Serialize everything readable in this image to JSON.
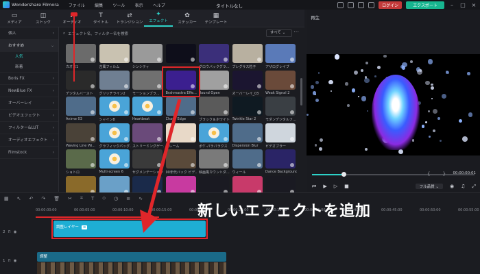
{
  "titlebar": {
    "app_name": "Wondershare Filmora",
    "menus": [
      "ファイル",
      "編集",
      "ツール",
      "表示",
      "ヘルプ"
    ],
    "doc_title": "タイトルなし",
    "login_label": "ログイン",
    "export_label": "エクスポート"
  },
  "toolbar": {
    "items": [
      {
        "label": "メディア",
        "icon": "media-icon"
      },
      {
        "label": "ストック",
        "icon": "stock-icon"
      },
      {
        "label": "オーディオ",
        "icon": "audio-icon"
      },
      {
        "label": "タイトル",
        "icon": "title-icon"
      },
      {
        "label": "トランジション",
        "icon": "transition-icon"
      },
      {
        "label": "エフェクト",
        "icon": "effects-icon",
        "active": true
      },
      {
        "label": "ステッカー",
        "icon": "sticker-icon"
      },
      {
        "label": "テンプレート",
        "icon": "template-icon"
      }
    ]
  },
  "sidebar": {
    "items": [
      {
        "label": "個人",
        "type": "main"
      },
      {
        "label": "おすすめ",
        "type": "main",
        "selected": true
      },
      {
        "label": "人気",
        "type": "sub",
        "on": true
      },
      {
        "label": "新着",
        "type": "sub"
      },
      {
        "label": "Boris FX",
        "type": "main"
      },
      {
        "label": "NewBlue FX",
        "type": "main"
      },
      {
        "label": "オーバーレイ",
        "type": "main"
      },
      {
        "label": "ビデオエフェクト",
        "type": "main"
      },
      {
        "label": "フィルター&LUT",
        "type": "main"
      },
      {
        "label": "オーディオエフェクト",
        "type": "main"
      },
      {
        "label": "Filmstock",
        "type": "main"
      }
    ]
  },
  "effects": {
    "search_placeholder": "エフェクト名、フィルター名を検索",
    "filter_value": "すべて",
    "items": [
      {
        "label": "カオス1",
        "bg": "#6b6b6b"
      },
      {
        "label": "古風フィルム",
        "bg": "#c9c2b1"
      },
      {
        "label": "シンシティ",
        "bg": "#9a9a9a"
      },
      {
        "label": "",
        "bg": "#0e0e1a"
      },
      {
        "label": "グロウバックグラ...",
        "bg": "#3b2f7a"
      },
      {
        "label": "ブレグサス粒子",
        "bg": "#b8b0a0"
      },
      {
        "label": "アザログレイブ",
        "bg": "#5a7ab8"
      },
      {
        "label": "デジタルバースト",
        "bg": "#2a2a2a"
      },
      {
        "label": "グリッチライン2",
        "bg": "#6f7f92"
      },
      {
        "label": "モーションブラ...",
        "bg": "#707070"
      },
      {
        "label": "Brahmastra Effe...",
        "bg": "#3b1f8f"
      },
      {
        "label": "Round Open",
        "bg": "#a0a0a0"
      },
      {
        "label": "オーバーレイ_03",
        "bg": "#1b1530"
      },
      {
        "label": "Weak Signal 2",
        "bg": "#6a4a3a"
      },
      {
        "label": "Anime 03",
        "bg": "#4f6c8a"
      },
      {
        "label": "シャイン8",
        "bg": "#4aa4d8"
      },
      {
        "label": "Heartbeat",
        "bg": "#4aa4d8"
      },
      {
        "label": "Chaos Edge",
        "bg": "#4f6c8a"
      },
      {
        "label": "ブラック＆ホワイト",
        "bg": "#5a5a5a"
      },
      {
        "label": "Twinkle Star 2",
        "bg": "#0f1a22"
      },
      {
        "label": "モダンデジタルフ...",
        "bg": "#3a3f44"
      },
      {
        "label": "Waving Line Wi...",
        "bg": "#4a4238"
      },
      {
        "label": "グラフィックパッグ...",
        "bg": "#4aa4d8"
      },
      {
        "label": "ストリーミングゲーム...",
        "bg": "#6a4a7a"
      },
      {
        "label": "フレーム",
        "bg": "#e8d9c8"
      },
      {
        "label": "ポケ-パラパラクス",
        "bg": "#4aa4d8"
      },
      {
        "label": "Dispersion Blur",
        "bg": "#4f6c8a"
      },
      {
        "label": "ビデオブラー",
        "bg": "#cfd6dd"
      },
      {
        "label": "ショトロ",
        "bg": "#5a6a4a"
      },
      {
        "label": "Multi-screen 6",
        "bg": "#4aa4d8"
      },
      {
        "label": "セグメンテーション",
        "bg": "#3a3a3a"
      },
      {
        "label": "90年代バック ビデ...",
        "bg": "#5a4a3a"
      },
      {
        "label": "映画風カウントダ...",
        "bg": "#7a7a7a"
      },
      {
        "label": "ウィール",
        "bg": "#4f6c8a"
      },
      {
        "label": "Dance Background",
        "bg": "#2a2466"
      },
      {
        "label": "",
        "bg": "#8a6a2a"
      },
      {
        "label": "",
        "bg": "#6aa0c8"
      },
      {
        "label": "",
        "bg": "#1a2a4a"
      },
      {
        "label": "",
        "bg": "#c83aa0"
      },
      {
        "label": "",
        "bg": "#1a1a22"
      },
      {
        "label": "",
        "bg": "#c83a6a"
      },
      {
        "label": "",
        "bg": "#1a1a22"
      }
    ]
  },
  "preview": {
    "title": "再生",
    "time": "00:00:00:01",
    "quality": "フル品質"
  },
  "timeline": {
    "ruler": [
      "00:00:00:00",
      "00:00:05:00",
      "00:00:10:00",
      "00:00:15:00",
      "00:00:20:00",
      "00:00:25:00",
      "00:00:30:00",
      "00:00:35:00",
      "00:00:40:00",
      "00:00:45:00",
      "00:00:50:00",
      "00:00:55:00"
    ],
    "track_labels": [
      "2",
      "1"
    ],
    "adjust_clip_label": "調整レイヤー",
    "video_clip_label": "調整"
  },
  "annotation": {
    "callout": "新しいエフェクトを追加"
  },
  "colors": {
    "accent": "#2dd2c8",
    "highlight": "#e0262a",
    "login": "#c23a3a",
    "export": "#17b58f",
    "adjust_clip": "#1eaed4"
  }
}
